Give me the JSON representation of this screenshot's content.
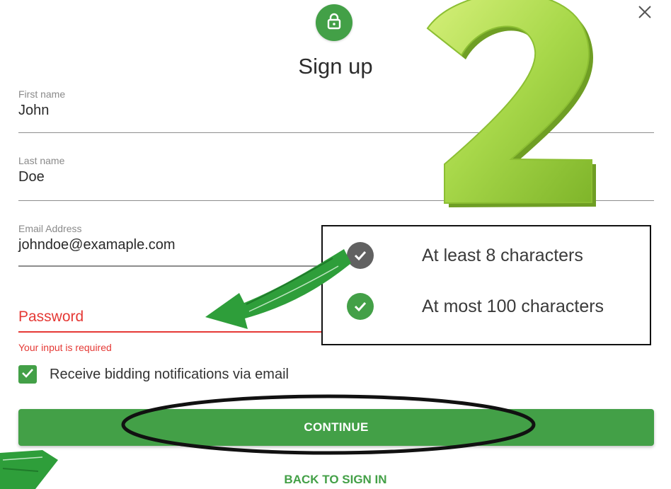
{
  "dialog": {
    "title": "Sign up",
    "close_icon": "close-icon",
    "lock_icon": "lock-icon"
  },
  "form": {
    "first_name": {
      "label": "First name",
      "value": "John"
    },
    "last_name": {
      "label": "Last name",
      "value": "Doe"
    },
    "email": {
      "label": "Email Address",
      "value": "johndoe@examaple.com"
    },
    "password": {
      "label": "Password",
      "value": "",
      "error": "Your input is required"
    },
    "notifications": {
      "label": "Receive bidding notifications via email",
      "checked": true
    }
  },
  "actions": {
    "continue_label": "CONTINUE",
    "back_label": "BACK TO SIGN IN"
  },
  "password_rules": [
    {
      "text": "At least 8 characters",
      "status": "neutral",
      "color": "#616161"
    },
    {
      "text": "At most 100 characters",
      "status": "passed",
      "color": "#43a047"
    }
  ],
  "annotations": {
    "step_number": "2",
    "step_number_color": "#a8d84a",
    "arrow_color": "#2e9e3a",
    "highlight_color": "#111111"
  },
  "colors": {
    "primary": "#43a047",
    "error": "#e53935",
    "text": "#2a2a2a",
    "muted": "#8a8a8a"
  }
}
